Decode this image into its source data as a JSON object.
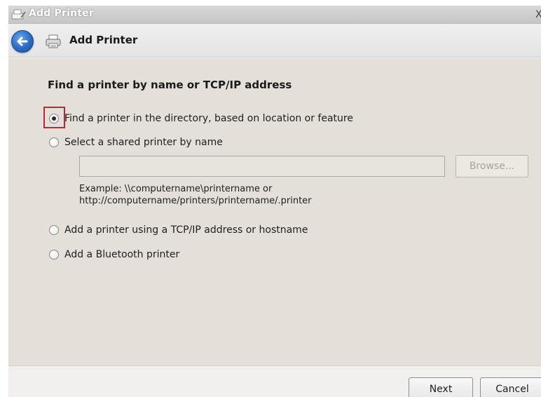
{
  "window": {
    "title": "Add Printer",
    "close_glyph": "X"
  },
  "header": {
    "back_icon": "back-arrow-icon",
    "printer_icon": "printer-icon",
    "title": "Add Printer"
  },
  "content": {
    "section_title": "Find a printer by name or TCP/IP address",
    "options": [
      {
        "label": "Find a printer in the directory, based on location or feature",
        "checked": true
      },
      {
        "label": "Select a shared printer by name",
        "checked": false
      },
      {
        "label": "Add a printer using a TCP/IP address or hostname",
        "checked": false
      },
      {
        "label": "Add a Bluetooth printer",
        "checked": false
      }
    ],
    "shared_printer_input": {
      "value": "",
      "enabled": false
    },
    "browse_label": "Browse...",
    "example_line1": "Example: \\\\computername\\printername or",
    "example_line2": "http://computername/printers/printername/.printer"
  },
  "footer": {
    "next_label": "Next",
    "cancel_label": "Cancel"
  },
  "colors": {
    "highlight": "#c0272d",
    "back_button": "#2b6bc4",
    "content_bg": "#e4e0d9"
  }
}
